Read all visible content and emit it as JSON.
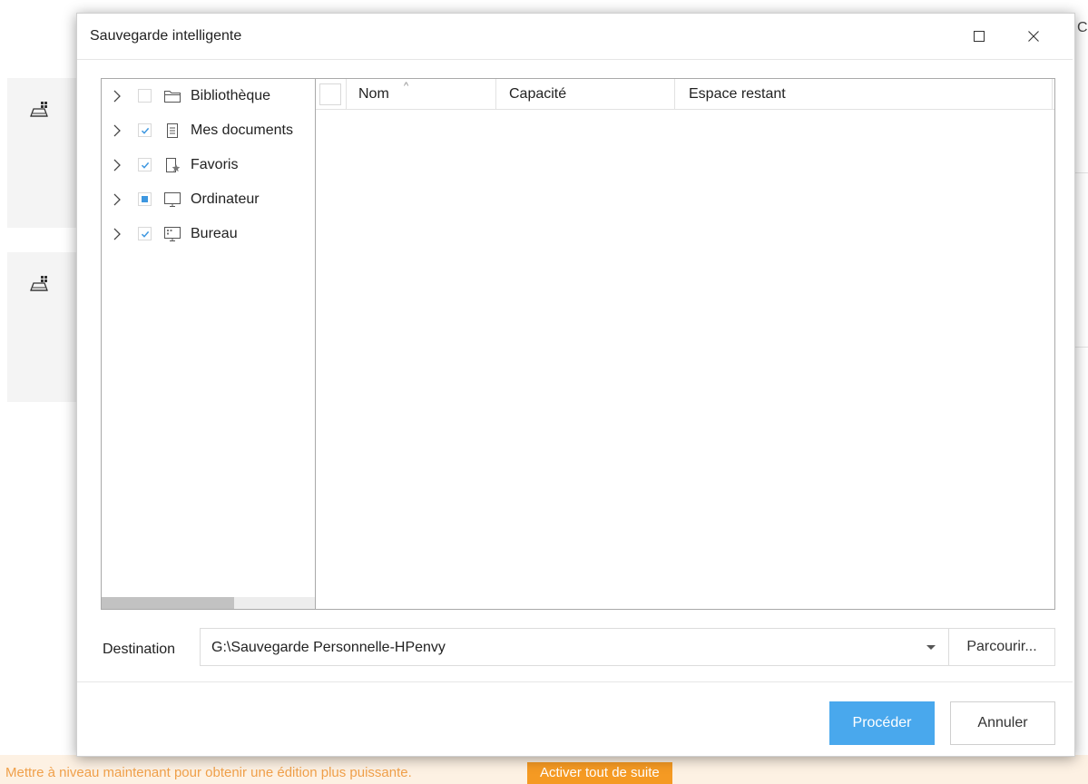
{
  "dialog": {
    "title": "Sauvegarde intelligente",
    "maximize_icon": "maximize-icon",
    "close_icon": "close-icon"
  },
  "tree": {
    "items": [
      {
        "label": "Bibliothèque",
        "state": "unchecked",
        "icon": "folder-icon"
      },
      {
        "label": "Mes documents",
        "state": "checked",
        "icon": "document-icon"
      },
      {
        "label": "Favoris",
        "state": "checked",
        "icon": "favorites-icon"
      },
      {
        "label": "Ordinateur",
        "state": "partial",
        "icon": "computer-icon"
      },
      {
        "label": "Bureau",
        "state": "checked",
        "icon": "desktop-icon"
      }
    ]
  },
  "list": {
    "columns": [
      "Nom",
      "Capacité",
      "Espace restant"
    ],
    "sort_indicator": "^"
  },
  "destination": {
    "label": "Destination",
    "value": "G:\\Sauvegarde Personnelle-HPenvy",
    "browse_label": "Parcourir..."
  },
  "buttons": {
    "proceed": "Procéder",
    "cancel": "Annuler"
  },
  "background": {
    "corner_char": "C",
    "banner_text": "Mettre à niveau maintenant pour obtenir une édition plus puissante.",
    "banner_button": "Activer tout de suite"
  },
  "colors": {
    "accent": "#49a8ed",
    "checkbox": "#3d97e0",
    "banner_button": "#f59a23",
    "banner_text": "#f0a04a"
  }
}
